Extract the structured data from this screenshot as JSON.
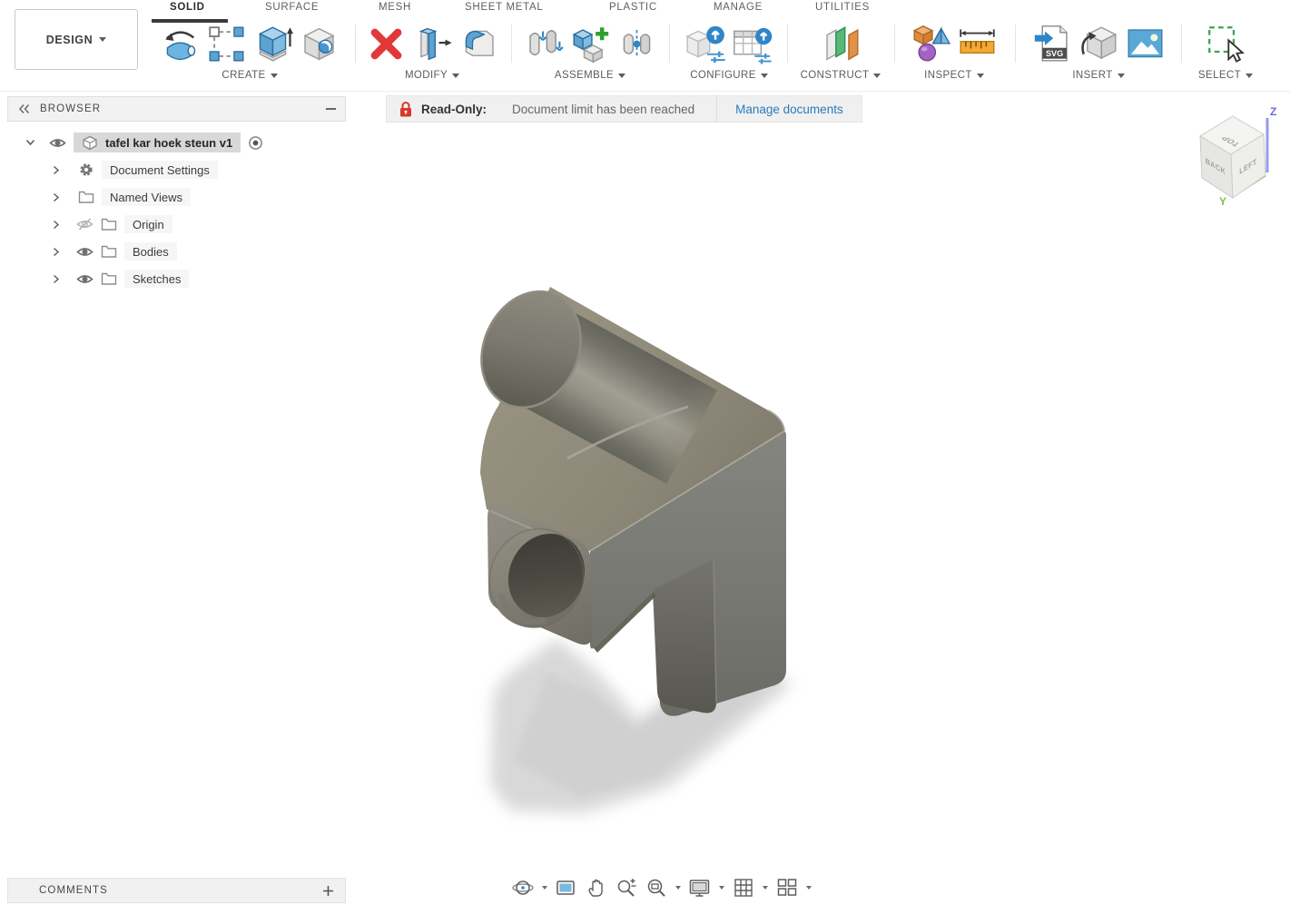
{
  "ribbon": {
    "design_label": "DESIGN",
    "tabs": [
      {
        "label": "SOLID",
        "active": true
      },
      {
        "label": "SURFACE",
        "active": false
      },
      {
        "label": "MESH",
        "active": false
      },
      {
        "label": "SHEET METAL",
        "active": false
      },
      {
        "label": "PLASTIC",
        "active": false
      },
      {
        "label": "MANAGE",
        "active": false
      },
      {
        "label": "UTILITIES",
        "active": false
      }
    ],
    "groups": {
      "create": {
        "label": "CREATE",
        "icons": [
          "revolve-icon",
          "create-sketch-icon",
          "extrude-icon",
          "hole-icon"
        ]
      },
      "modify": {
        "label": "MODIFY",
        "icons": [
          "delete-icon",
          "press-pull-icon",
          "fillet-icon"
        ]
      },
      "assemble": {
        "label": "ASSEMBLE",
        "icons": [
          "joint-icon",
          "new-component-icon",
          "joint-origin-icon"
        ]
      },
      "configure": {
        "label": "CONFIGURE",
        "icons": [
          "configure-icon",
          "configuration-table-icon"
        ]
      },
      "construct": {
        "label": "CONSTRUCT",
        "icons": [
          "construction-plane-icon"
        ]
      },
      "inspect": {
        "label": "INSPECT",
        "icons": [
          "measure-icon",
          "ruler-icon"
        ]
      },
      "insert": {
        "label": "INSERT",
        "icons": [
          "insert-svg-icon",
          "insert-mesh-icon",
          "canvas-icon"
        ],
        "svg_badge": "SVG"
      },
      "select": {
        "label": "SELECT",
        "icons": [
          "select-icon"
        ]
      }
    }
  },
  "banner": {
    "lock_icon": "lock-icon",
    "label": "Read-Only:",
    "message": "Document limit has been reached",
    "link": "Manage documents"
  },
  "browser": {
    "title": "BROWSER",
    "collapse_icon": "double-chevron-left-icon",
    "minimize_icon": "minus-icon",
    "root": {
      "label": "tafel kar hoek steun v1",
      "visible": true,
      "activated": true,
      "icon": "component-icon"
    },
    "items": [
      {
        "label": "Document Settings",
        "icon": "gear-icon",
        "visibility": null
      },
      {
        "label": "Named Views",
        "icon": "folder-icon",
        "visibility": null
      },
      {
        "label": "Origin",
        "icon": "folder-icon",
        "visibility": "hidden"
      },
      {
        "label": "Bodies",
        "icon": "folder-icon",
        "visibility": "visible"
      },
      {
        "label": "Sketches",
        "icon": "folder-icon",
        "visibility": "visible"
      }
    ]
  },
  "comments": {
    "title": "COMMENTS",
    "add_icon": "plus-icon"
  },
  "viewcube": {
    "top": "TOP",
    "back": "BACK",
    "left": "LEFT",
    "axis_z": "Z",
    "axis_y": "Y",
    "axis_z_color": "#6a6ae0",
    "axis_y_color": "#85bb4f"
  },
  "navbar": {
    "icons": [
      "orbit-icon",
      "look-at-icon",
      "pan-icon",
      "zoom-icon",
      "zoom-window-icon",
      "display-settings-icon",
      "grid-icon",
      "viewports-icon"
    ]
  },
  "model": {
    "name": "tafel kar hoek steun v1",
    "description": "L-shaped corner bracket with round tube arm, bored square arm and vertical leg",
    "material_color": "#8a877a"
  },
  "colors": {
    "accent_blue": "#4596d1",
    "link_blue": "#2a7cbc",
    "error_red": "#d9372a",
    "active_tab_underline": "#3a3a3a",
    "construct_green": "#58b878",
    "construct_orange": "#e2914a"
  }
}
